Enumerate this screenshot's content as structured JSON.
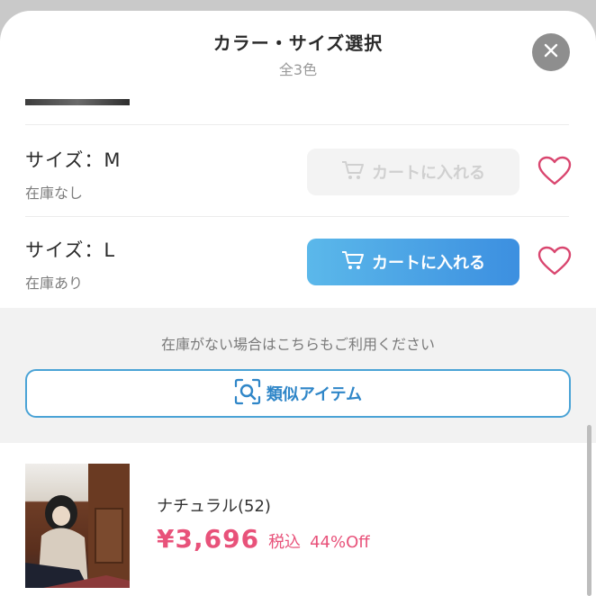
{
  "header": {
    "title": "カラー・サイズ選択",
    "subtitle": "全3色"
  },
  "sizes": [
    {
      "label": "サイズ：M",
      "stock": "在庫なし",
      "cart_label": "カートに入れる",
      "enabled": false
    },
    {
      "label": "サイズ：L",
      "stock": "在庫あり",
      "cart_label": "カートに入れる",
      "enabled": true
    }
  ],
  "out_of_stock": {
    "note": "在庫がない場合はこちらもご利用ください",
    "similar_label": "類似アイテム"
  },
  "product": {
    "color_name": "ナチュラル(52)",
    "price": "¥3,696",
    "tax_label": "税込",
    "discount": "44%Off"
  },
  "colors": {
    "accent_blue": "#3c8fe0",
    "price_pink": "#e8527a",
    "heart_pink": "#d9466f",
    "disabled_gray": "#f3f3f3"
  },
  "icons": {
    "close": "close-icon",
    "cart": "cart-icon",
    "heart": "heart-outline-icon",
    "search": "search-scan-icon"
  }
}
